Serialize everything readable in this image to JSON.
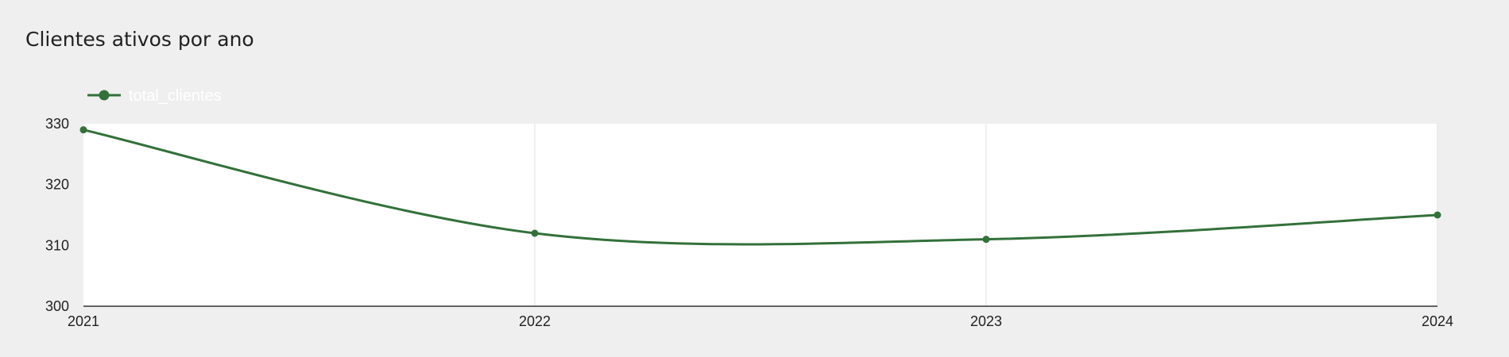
{
  "chart_data": {
    "type": "line",
    "title": "Clientes ativos por ano",
    "xlabel": "",
    "ylabel": "",
    "categories": [
      "2021",
      "2022",
      "2023",
      "2024"
    ],
    "series": [
      {
        "name": "total_clientes",
        "values": [
          329,
          312,
          311,
          315
        ]
      }
    ],
    "ylim": [
      300,
      330
    ],
    "yticks": [
      300,
      310,
      320,
      330
    ],
    "legend_position": "top-left",
    "grid": "vertical",
    "smooth": true,
    "colors": {
      "series": "#33703a",
      "plot_background": "#ffffff",
      "page_background": "#efefef",
      "gridline": "#e0e0e0",
      "axis": "#333333",
      "legend_text": "#ffffff"
    }
  }
}
